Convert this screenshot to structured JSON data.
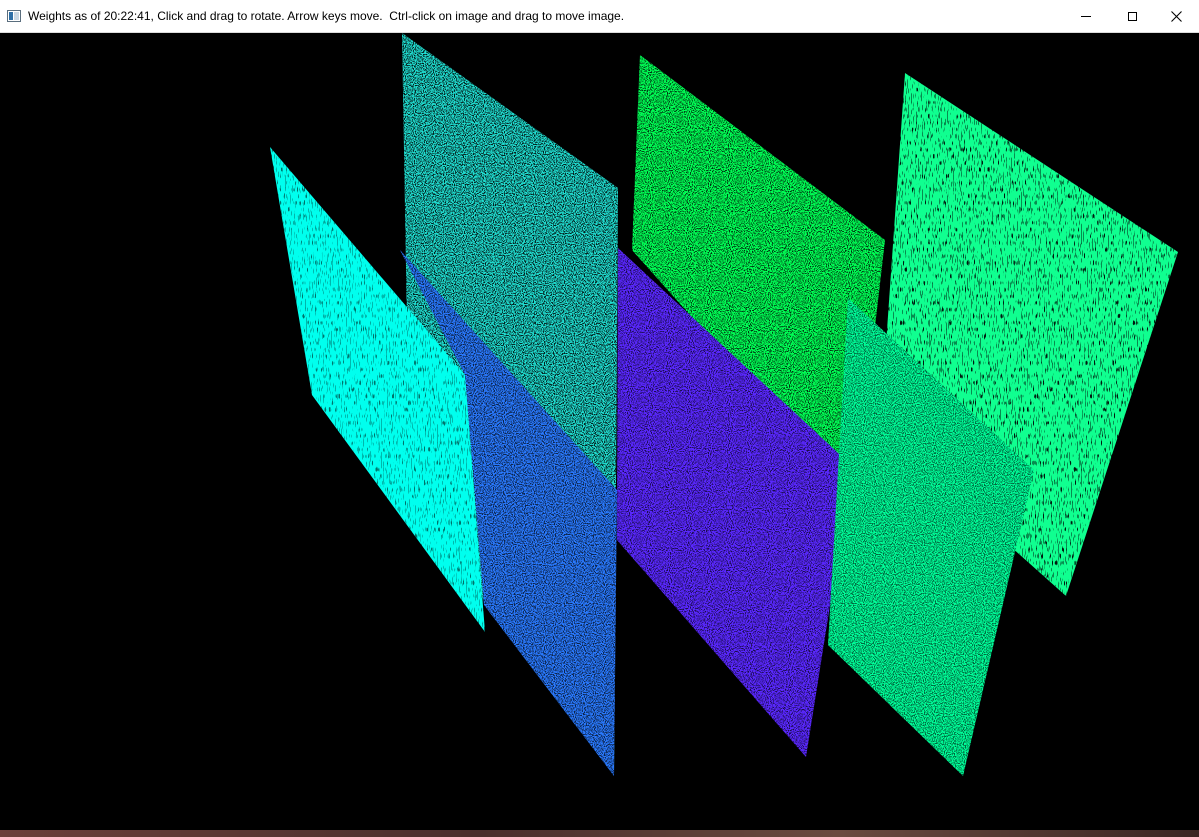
{
  "window": {
    "title": "Weights as of 20:22:41, Click and drag to rotate. Arrow keys move.  Ctrl-click on image and drag to move image.",
    "icon": "app-window-icon",
    "controls": {
      "minimize": "minimize-icon",
      "maximize": "maximize-icon",
      "close": "close-icon"
    }
  },
  "scene": {
    "background_color": "#000000",
    "planes": [
      {
        "name": "layer-plane-1",
        "base_color": "#00ffee",
        "speckle_color": "#1a5cff"
      },
      {
        "name": "layer-plane-2",
        "base_color": "#2a7aff",
        "speckle_color": "#00e0ff"
      },
      {
        "name": "layer-plane-3",
        "base_color": "#20ddd0",
        "speckle_color": "#1e3aff"
      },
      {
        "name": "layer-plane-4",
        "base_color": "#5a28ff",
        "speckle_color": "#c020ff"
      },
      {
        "name": "layer-plane-5",
        "base_color": "#00ff55",
        "speckle_color": "#00ff88"
      },
      {
        "name": "layer-plane-6",
        "base_color": "#00ff9a",
        "speckle_color": "#1a60ff"
      },
      {
        "name": "layer-plane-7",
        "base_color": "#10ff90",
        "speckle_color": "#2050ff"
      }
    ]
  }
}
